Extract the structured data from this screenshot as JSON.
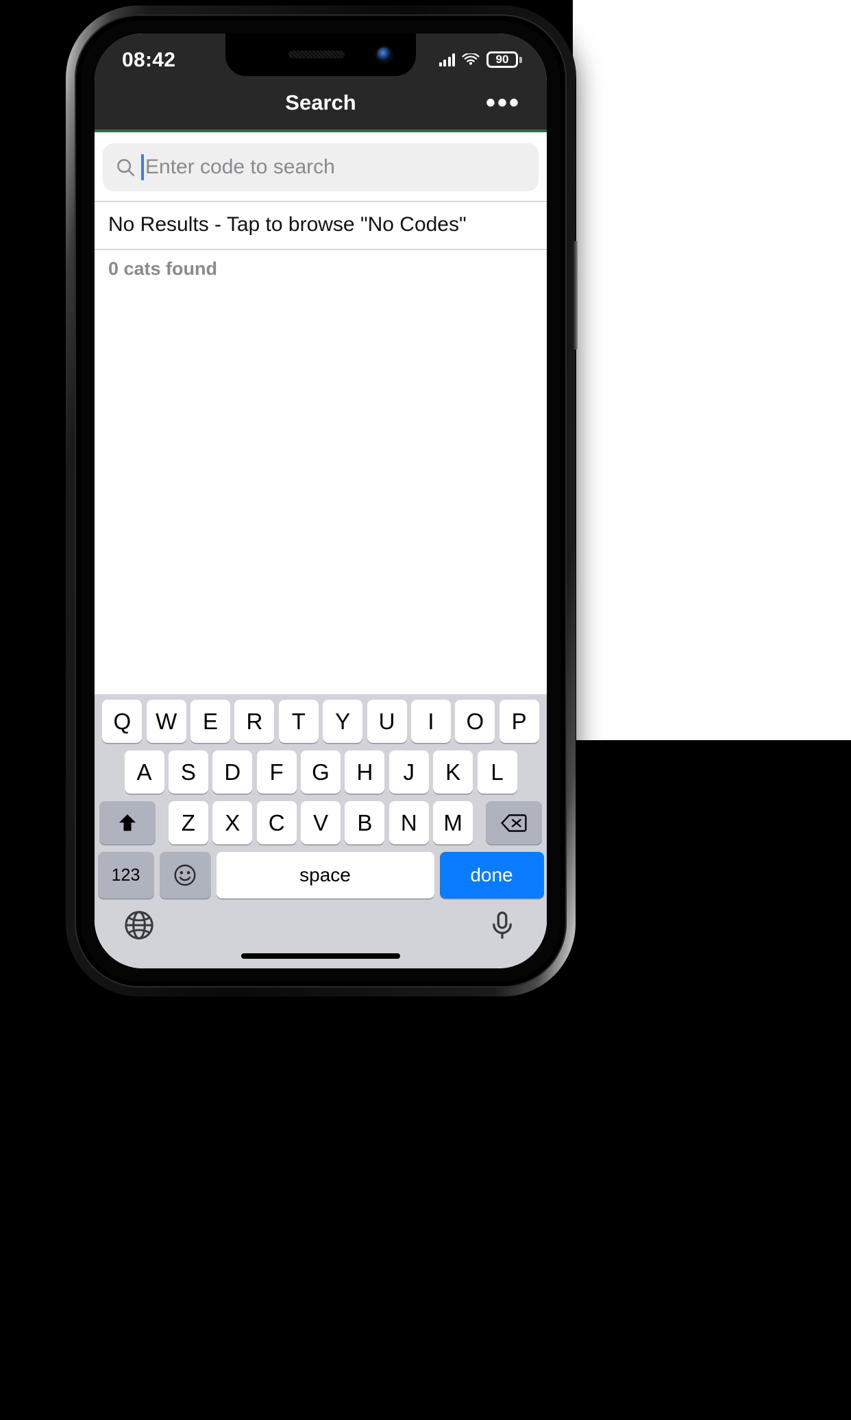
{
  "status_bar": {
    "time": "08:42",
    "signal_icon": "cellular-signal-icon",
    "wifi_icon": "wifi-icon",
    "battery_level": "90"
  },
  "nav_bar": {
    "title": "Search",
    "more_label": "•••",
    "divider_color": "#2f6b3f"
  },
  "search": {
    "placeholder": "Enter code to search",
    "value": "",
    "icon": "search-icon"
  },
  "results": {
    "empty_title": "No Results - Tap to browse \"No Codes\"",
    "count_text": "0 cats found"
  },
  "keyboard": {
    "row1": [
      "Q",
      "W",
      "E",
      "R",
      "T",
      "Y",
      "U",
      "I",
      "O",
      "P"
    ],
    "row2": [
      "A",
      "S",
      "D",
      "F",
      "G",
      "H",
      "J",
      "K",
      "L"
    ],
    "row3": [
      "Z",
      "X",
      "C",
      "V",
      "B",
      "N",
      "M"
    ],
    "shift_icon": "shift-arrow-icon",
    "backspace_icon": "backspace-icon",
    "numeric_label": "123",
    "emoji_icon": "emoji-smiley-icon",
    "space_label": "space",
    "done_label": "done",
    "done_color": "#0A7CFF",
    "globe_icon": "globe-icon",
    "mic_icon": "microphone-icon"
  }
}
